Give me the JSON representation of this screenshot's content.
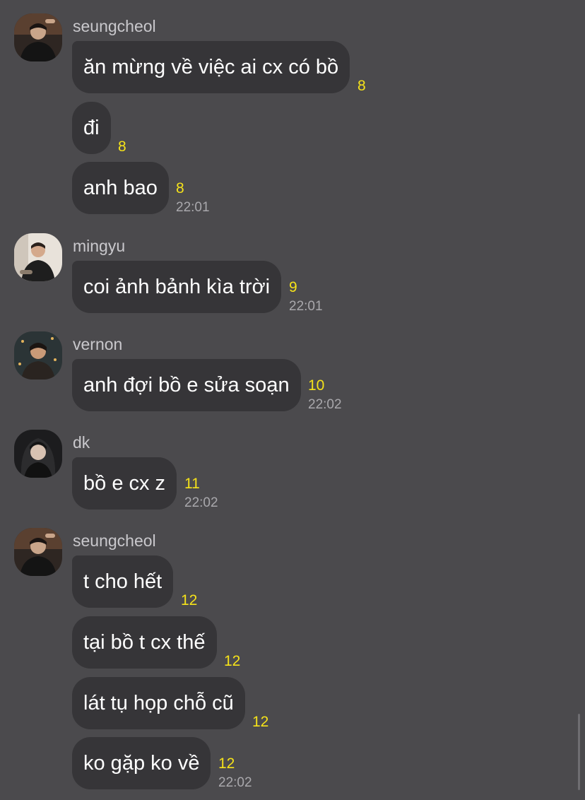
{
  "groups": [
    {
      "sender": "seungcheol",
      "avatar_icon": "profile-photo-icon",
      "messages": [
        {
          "text": "ăn mừng về việc ai cx có bồ",
          "unread": "8"
        },
        {
          "text": "đi",
          "unread": "8"
        },
        {
          "text": "anh bao",
          "unread": "8",
          "time": "22:01"
        }
      ]
    },
    {
      "sender": "mingyu",
      "avatar_icon": "profile-photo-icon",
      "messages": [
        {
          "text": "coi ảnh bảnh kìa trời",
          "unread": "9",
          "time": "22:01"
        }
      ]
    },
    {
      "sender": "vernon",
      "avatar_icon": "profile-photo-icon",
      "messages": [
        {
          "text": "anh đợi bồ e sửa soạn",
          "unread": "10",
          "time": "22:02"
        }
      ]
    },
    {
      "sender": "dk",
      "avatar_icon": "profile-photo-icon",
      "messages": [
        {
          "text": "bồ e cx z",
          "unread": "11",
          "time": "22:02"
        }
      ]
    },
    {
      "sender": "seungcheol",
      "avatar_icon": "profile-photo-icon",
      "messages": [
        {
          "text": "t cho hết",
          "unread": "12"
        },
        {
          "text": "tại bồ t cx thế",
          "unread": "12"
        },
        {
          "text": "lát tụ họp chỗ cũ",
          "unread": "12"
        },
        {
          "text": "ko gặp ko về",
          "unread": "12",
          "time": "22:02"
        }
      ]
    }
  ],
  "colors": {
    "background": "#4b4a4d",
    "bubble": "#363538",
    "unread": "#f5e21a",
    "sender": "#c9c8cc",
    "time": "#a9a8ac"
  }
}
